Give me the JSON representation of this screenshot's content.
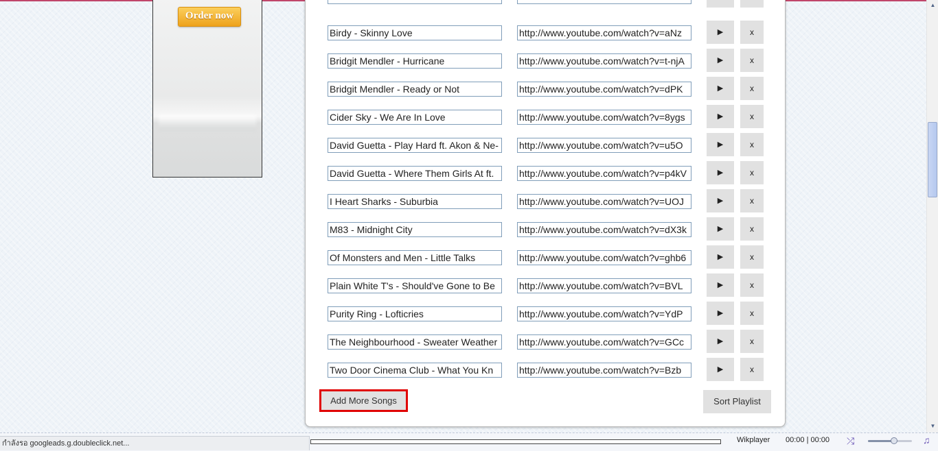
{
  "ad": {
    "order_label": "Order now"
  },
  "playlist": {
    "songs": [
      {
        "title": "Birdy - Skinny Love",
        "url": "http://www.youtube.com/watch?v=aNz"
      },
      {
        "title": "Bridgit Mendler - Hurricane",
        "url": "http://www.youtube.com/watch?v=t-njA"
      },
      {
        "title": "Bridgit Mendler - Ready or Not",
        "url": "http://www.youtube.com/watch?v=dPK"
      },
      {
        "title": "Cider Sky - We Are In Love",
        "url": "http://www.youtube.com/watch?v=8ygs"
      },
      {
        "title": "David Guetta - Play Hard ft. Akon & Ne-",
        "url": "http://www.youtube.com/watch?v=u5O"
      },
      {
        "title": "David Guetta - Where Them Girls At ft.",
        "url": "http://www.youtube.com/watch?v=p4kV"
      },
      {
        "title": "I Heart Sharks - Suburbia",
        "url": "http://www.youtube.com/watch?v=UOJ"
      },
      {
        "title": "M83 - Midnight City",
        "url": "http://www.youtube.com/watch?v=dX3k"
      },
      {
        "title": "Of Monsters and Men - Little Talks",
        "url": "http://www.youtube.com/watch?v=ghb6"
      },
      {
        "title": "Plain White T's - Should've Gone to Be",
        "url": "http://www.youtube.com/watch?v=BVL"
      },
      {
        "title": "Purity Ring - Lofticries",
        "url": "http://www.youtube.com/watch?v=YdP"
      },
      {
        "title": "The Neighbourhood - Sweater Weather",
        "url": "http://www.youtube.com/watch?v=GCc"
      },
      {
        "title": "Two Door Cinema Club - What You Kn",
        "url": "http://www.youtube.com/watch?v=Bzb"
      }
    ],
    "play_symbol": "▶",
    "delete_symbol": "x",
    "add_more_label": "Add More Songs",
    "sort_label": "Sort Playlist"
  },
  "player": {
    "status_text": "กำลังรอ googleads.g.doubleclick.net...",
    "name": "Wikplayer",
    "time": "00:00 | 00:00",
    "volume_fraction": 0.6
  },
  "icons": {
    "shuffle": "shuffle-icon",
    "playlist": "playlist-icon",
    "scroll_up": "scroll-up-arrow",
    "scroll_down": "scroll-down-arrow"
  },
  "colors": {
    "order_button": "#f3b52d",
    "highlight_border": "#e00000"
  }
}
